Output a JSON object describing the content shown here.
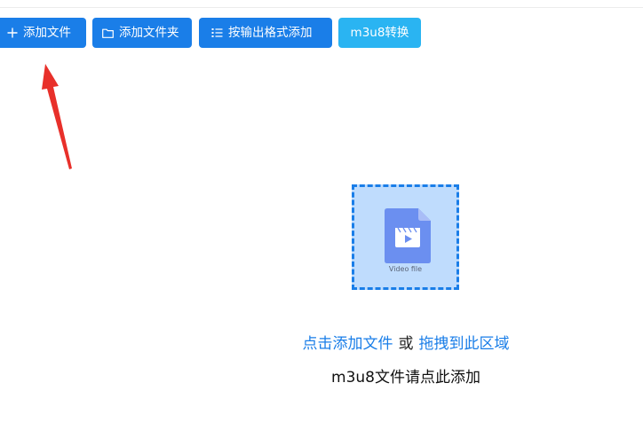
{
  "toolbar": {
    "add_file_label": "添加文件",
    "add_folder_label": "添加文件夹",
    "add_by_format_label": "按输出格式添加",
    "m3u8_convert_label": "m3u8转换"
  },
  "icons": {
    "add_file": "plus-icon",
    "add_folder": "folder-icon",
    "add_by_format": "list-icon",
    "drop_area": "video-file-icon",
    "annotation": "red-arrow"
  },
  "drop_area": {
    "file_caption": "Video file",
    "click_to_add": "点击添加文件",
    "or_word": "或",
    "drag_here": "拖拽到此区域",
    "m3u8_hint": "m3u8文件请点此添加"
  },
  "colors": {
    "primary": "#1a7ee8",
    "m3u8_button": "#2ab4f2",
    "drop_fill": "#bfdcfd",
    "file_icon": "#6b8ff0",
    "annotation_arrow": "#e8302a"
  }
}
